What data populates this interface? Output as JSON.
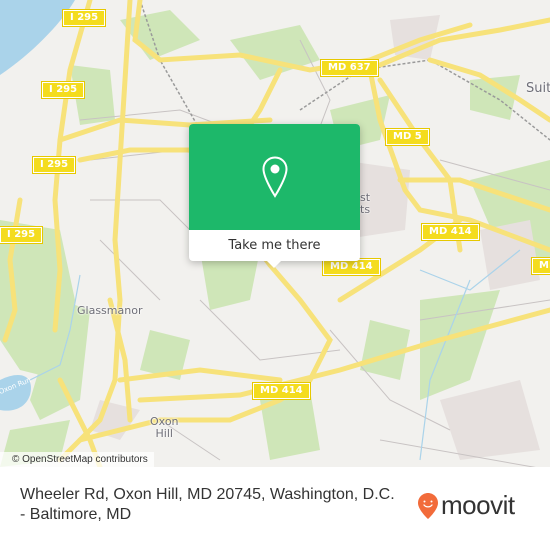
{
  "map": {
    "popup": {
      "cta_label": "Take me there",
      "icon": "map-pin-icon",
      "accent_color": "#1db86a"
    },
    "road_shields": [
      {
        "id": "i295-top",
        "label": "I 295"
      },
      {
        "id": "i295-mid",
        "label": "I 295"
      },
      {
        "id": "i295-low",
        "label": "I 295"
      },
      {
        "id": "i295-left",
        "label": "I 295"
      },
      {
        "id": "md637",
        "label": "MD 637"
      },
      {
        "id": "md5",
        "label": "MD 5"
      },
      {
        "id": "md414-a",
        "label": "MD 414"
      },
      {
        "id": "md414-b",
        "label": "MD 414"
      },
      {
        "id": "md414-c",
        "label": "MD 414"
      },
      {
        "id": "md414-edge",
        "label": "MD"
      }
    ],
    "place_labels": {
      "glassmanor": "Glassmanor",
      "oxon_hill_line1": "Oxon",
      "oxon_hill_line2": "Hill",
      "suitland_partial": "Suit",
      "forest_heights_line1": "st",
      "forest_heights_line2": "ts",
      "oxon_run": "Oxon Run"
    },
    "attribution": "© OpenStreetMap contributors"
  },
  "footer": {
    "address": "Wheeler Rd, Oxon Hill, MD 20745, Washington, D.C. - Baltimore, MD",
    "brand_name": "moovit",
    "brand_color": "#f26b3a"
  }
}
